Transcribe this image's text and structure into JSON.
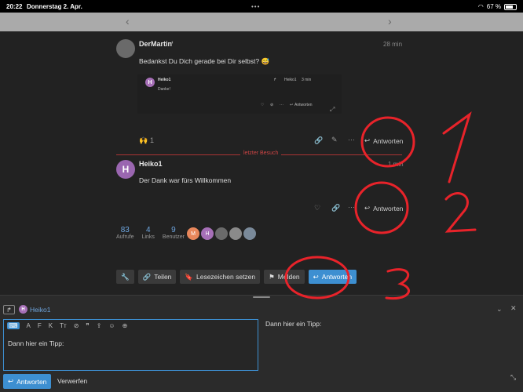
{
  "statusbar": {
    "time": "20:22",
    "date": "Donnerstag 2. Apr.",
    "battery": "67 %",
    "dots": "•••"
  },
  "nav": {
    "back": "‹",
    "forward": "›"
  },
  "post1": {
    "author": "DerMartin",
    "time": "28 min",
    "text": "Bedankst Du Dich gerade bei Dir selbst? 😅",
    "reaction_count": "1",
    "reply_label": "Antworten",
    "quote": {
      "avatar_letter": "H",
      "author": "Heiko1",
      "text": "Danke!",
      "reply_to": "Heiko1",
      "time": "3 min",
      "reply_label": "Antworten"
    }
  },
  "divider": {
    "label": "letzter Besuch"
  },
  "post2": {
    "avatar_letter": "H",
    "author": "Heiko1",
    "time": "1 min",
    "text": "Der Dank war fürs Willkommen",
    "reply_label": "Antworten"
  },
  "stats": [
    {
      "num": "83",
      "label": "Aufrufe"
    },
    {
      "num": "4",
      "label": "Links"
    },
    {
      "num": "9",
      "label": "Benutzer"
    }
  ],
  "participants": [
    {
      "letter": "M",
      "color": "#e8875b"
    },
    {
      "letter": "H",
      "color": "#a66fb7"
    },
    {
      "letter": "",
      "color": "#6a6a6a"
    },
    {
      "letter": "",
      "color": "#8a8a8a"
    },
    {
      "letter": "",
      "color": "#7a8a9a"
    }
  ],
  "actions": {
    "share": "Teilen",
    "bookmark": "Lesezeichen setzen",
    "flag": "Melden",
    "reply": "Antworten"
  },
  "composer": {
    "target_letter": "H",
    "target": "Heiko1",
    "toolbar": [
      "A",
      "F",
      "K"
    ],
    "content": "Dann hier ein Tipp:",
    "preview": "Dann hier ein Tipp:",
    "send": "Antworten",
    "discard": "Verwerfen"
  },
  "annotations": [
    "1",
    "2",
    "3"
  ],
  "colors": {
    "accent": "#3d8fd1",
    "annotation": "#e8232a",
    "divider": "#cc4444"
  }
}
